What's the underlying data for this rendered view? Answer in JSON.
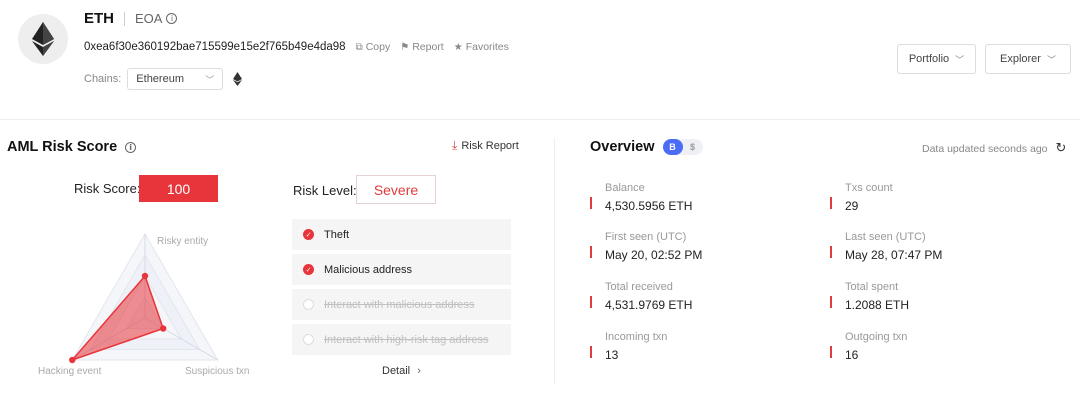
{
  "header": {
    "symbol": "ETH",
    "account_type": "EOA",
    "address": "0xea6f30e360192bae715599e15e2f765b49e4da98",
    "actions": [
      {
        "label": "Copy",
        "icon": "copy-icon"
      },
      {
        "label": "Report",
        "icon": "flag-icon"
      },
      {
        "label": "Favorites",
        "icon": "star-icon"
      }
    ],
    "chains_label": "Chains:",
    "chain_selected": "Ethereum",
    "portfolio_label": "Portfolio",
    "explorer_label": "Explorer"
  },
  "aml": {
    "title": "AML Risk Score",
    "risk_report_label": "Risk Report",
    "risk_score_label": "Risk Score:",
    "risk_score": "100",
    "risk_level_label": "Risk Level:",
    "risk_level": "Severe",
    "radar_labels": {
      "top": "Risky entity",
      "left": "Hacking event",
      "right": "Suspicious txn"
    },
    "radar_values": {
      "risky_entity": 0.5,
      "hacking_event": 1.0,
      "suspicious_txn": 0.25
    },
    "risk_items": [
      {
        "label": "Theft",
        "checked": true
      },
      {
        "label": "Malicious address",
        "checked": true
      },
      {
        "label": "Interact with malicious address",
        "checked": false
      },
      {
        "label": "Interact with high-risk tag address",
        "checked": false
      }
    ],
    "detail_label": "Detail"
  },
  "overview": {
    "title": "Overview",
    "toggle_a": "B",
    "toggle_b": "$",
    "updated": "Data updated seconds ago",
    "stats_left": [
      {
        "label": "Balance",
        "value": "4,530.5956 ETH"
      },
      {
        "label": "First seen (UTC)",
        "value": "May 20, 02:52 PM"
      },
      {
        "label": "Total received",
        "value": "4,531.9769 ETH"
      },
      {
        "label": "Incoming txn",
        "value": "13"
      }
    ],
    "stats_right": [
      {
        "label": "Txs count",
        "value": "29"
      },
      {
        "label": "Last seen (UTC)",
        "value": "May 28, 07:47 PM"
      },
      {
        "label": "Total spent",
        "value": "1.2088 ETH"
      },
      {
        "label": "Outgoing txn",
        "value": "16"
      }
    ]
  },
  "colors": {
    "accent_red": "#e8353b",
    "toggle_blue": "#4a6cf7"
  }
}
